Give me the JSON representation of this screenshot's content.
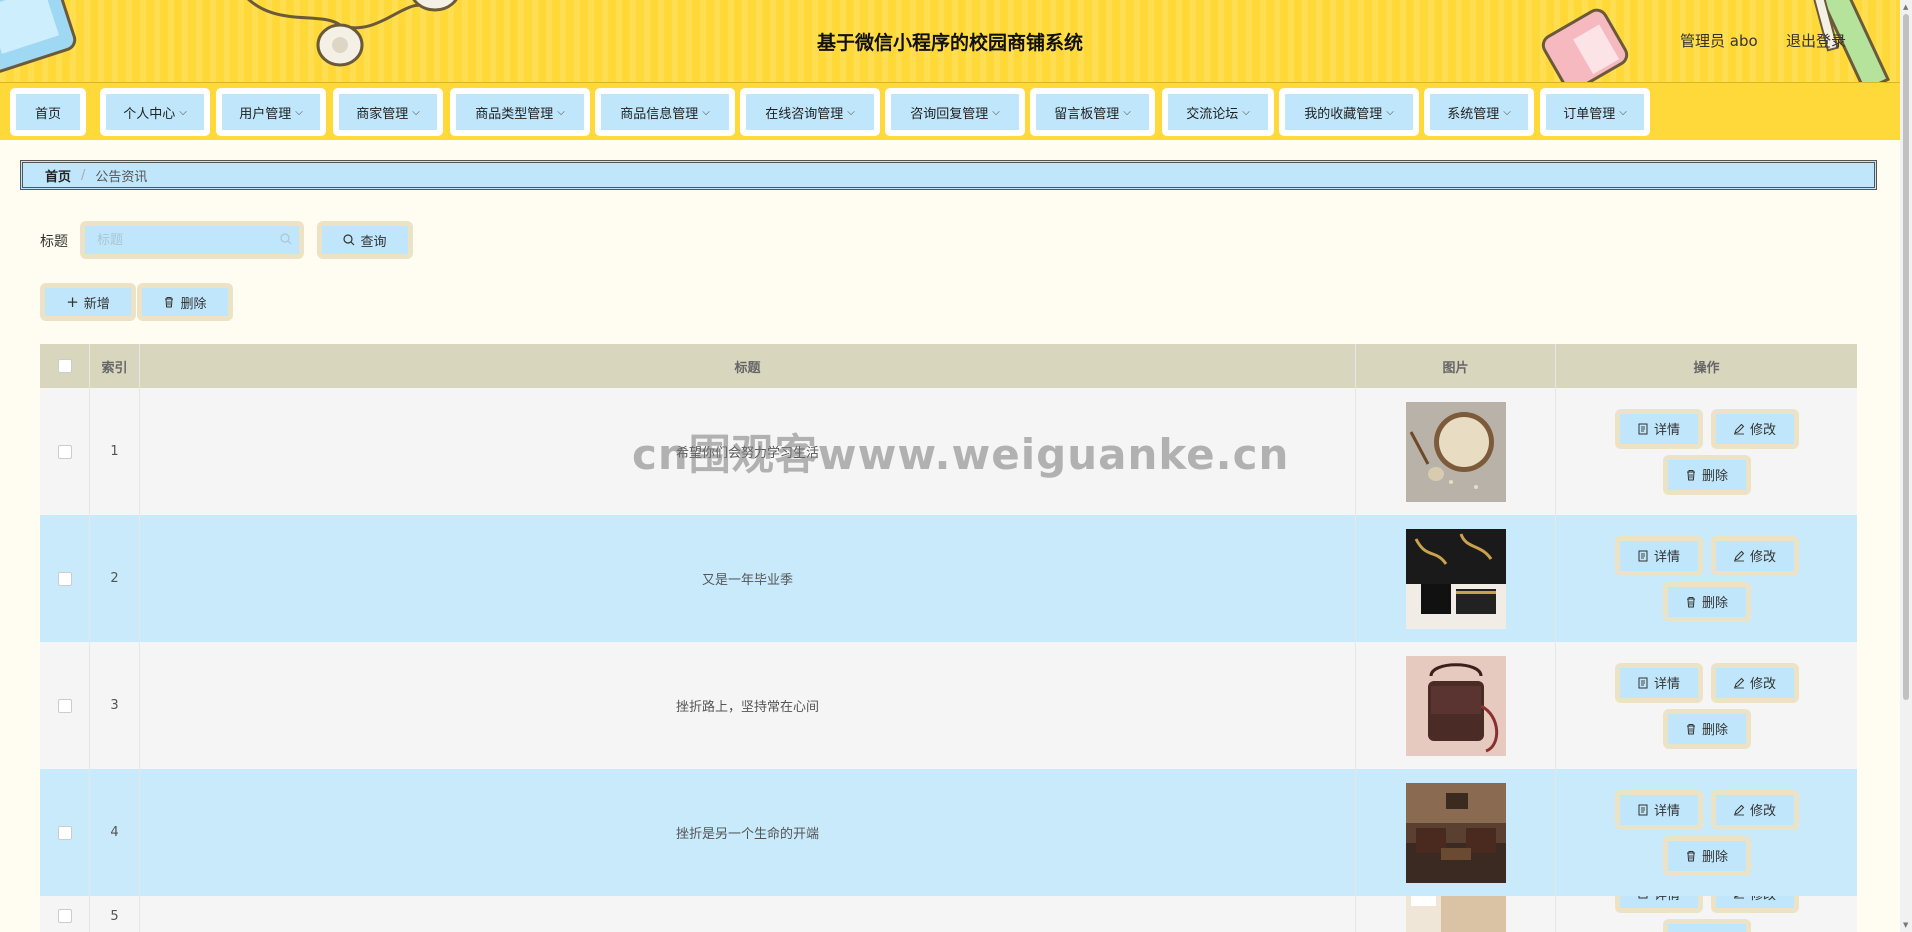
{
  "header": {
    "title": "基于微信小程序的校园商铺系统",
    "admin": "管理员 abo",
    "logout": "退出登录"
  },
  "nav": [
    {
      "label": "首页",
      "dropdown": false
    },
    {
      "label": "个人中心",
      "dropdown": true
    },
    {
      "label": "用户管理",
      "dropdown": true
    },
    {
      "label": "商家管理",
      "dropdown": true
    },
    {
      "label": "商品类型管理",
      "dropdown": true
    },
    {
      "label": "商品信息管理",
      "dropdown": true
    },
    {
      "label": "在线咨询管理",
      "dropdown": true
    },
    {
      "label": "咨询回复管理",
      "dropdown": true
    },
    {
      "label": "留言板管理",
      "dropdown": true
    },
    {
      "label": "交流论坛",
      "dropdown": true
    },
    {
      "label": "我的收藏管理",
      "dropdown": true
    },
    {
      "label": "系统管理",
      "dropdown": true
    },
    {
      "label": "订单管理",
      "dropdown": true
    }
  ],
  "breadcrumb": {
    "home": "首页",
    "separator": "/",
    "current": "公告资讯"
  },
  "search": {
    "label": "标题",
    "placeholder": "标题",
    "query_button": "查询"
  },
  "actions": {
    "add": "新增",
    "delete": "删除"
  },
  "table": {
    "headers": {
      "index": "索引",
      "title": "标题",
      "image": "图片",
      "ops": "操作"
    },
    "op_labels": {
      "detail": "详情",
      "edit": "修改",
      "delete": "删除"
    },
    "rows": [
      {
        "index": "1",
        "title": "希望你们会努力学习生活",
        "image": "oats-bowl-spoon"
      },
      {
        "index": "2",
        "title": "又是一年毕业季",
        "image": "black-gift-box"
      },
      {
        "index": "3",
        "title": "挫折路上，坚持常在心间",
        "image": "brown-leather-handbag"
      },
      {
        "index": "4",
        "title": "挫折是另一个生命的开端",
        "image": "wooden-living-room"
      },
      {
        "index": "5",
        "title": "",
        "image": "bright-interior"
      }
    ]
  },
  "watermark": "cn围观客www.weiguanke.cn",
  "colors": {
    "header_yellow": "#ffd93a",
    "light_blue": "#bfe6fa",
    "row_blue": "#c8eafb",
    "row_grey": "#f5f5f5",
    "table_header": "#d9d6be",
    "button_border": "#ece3c6",
    "page_bg": "#fffdf1"
  }
}
